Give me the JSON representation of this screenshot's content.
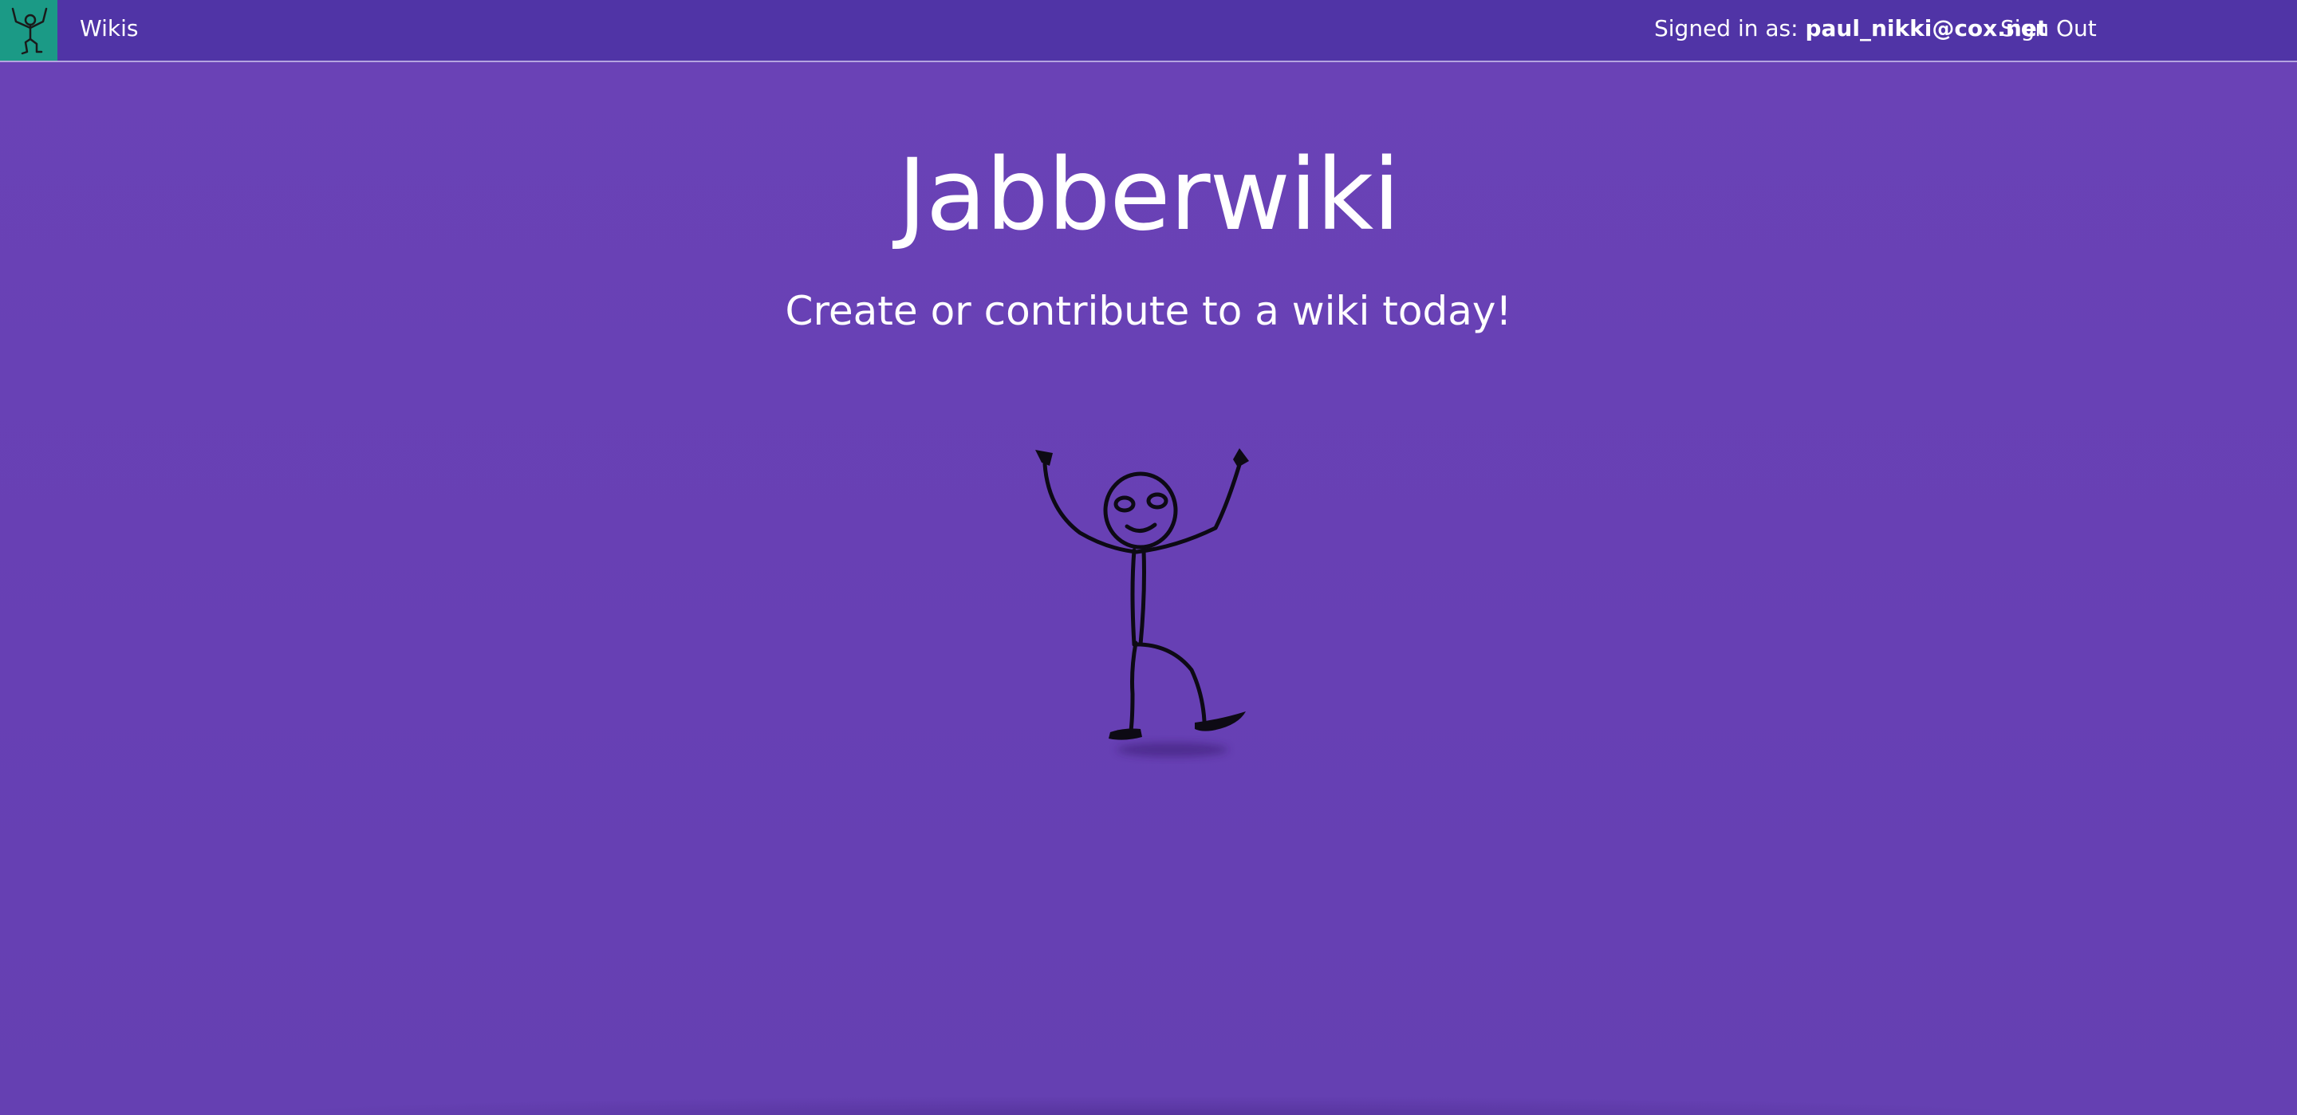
{
  "navbar": {
    "wikis_label": "Wikis",
    "signed_in_prefix": "Signed in as:",
    "signed_in_email": "paul_nikki@cox.net",
    "sign_out_label": "Sign Out"
  },
  "hero": {
    "title": "Jabberwiki",
    "subtitle": "Create or contribute to a wiki today!"
  },
  "icons": {
    "logo": "stick-figure-logo-icon",
    "mascot": "stick-figure-mascot"
  },
  "colors": {
    "background": "#6740b4",
    "navbar": "#5034a6",
    "brand_tile": "#1b9a86",
    "text": "#ffffff"
  }
}
